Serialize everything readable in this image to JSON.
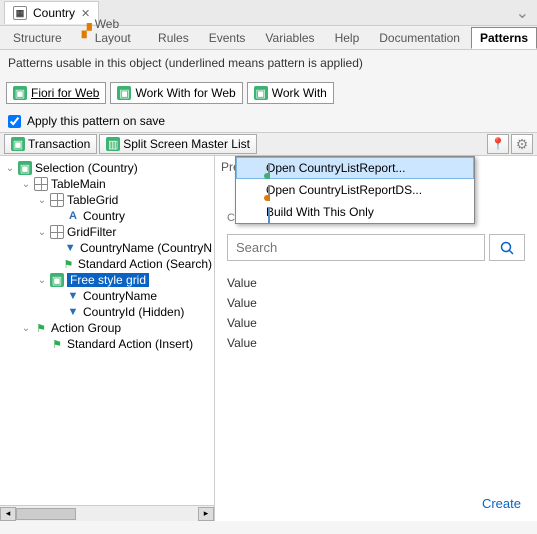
{
  "tab": {
    "title": "Country"
  },
  "subtabs": [
    "Structure",
    "Web Layout",
    "Rules",
    "Events",
    "Variables",
    "Help",
    "Documentation",
    "Patterns"
  ],
  "active_subtab": 7,
  "desc": "Patterns usable in this object (underlined means pattern is applied)",
  "pills": [
    {
      "label": "Fiori for Web",
      "applied": true
    },
    {
      "label": "Work With for Web",
      "applied": false
    },
    {
      "label": "Work With",
      "applied": false
    }
  ],
  "apply_label": "Apply this pattern on save",
  "apply_checked": true,
  "toolbar2": {
    "btn1": "Transaction",
    "btn2": "Split Screen Master List"
  },
  "tree": [
    {
      "ind": 0,
      "tw": "v",
      "icon": "green",
      "label": "Selection (Country)"
    },
    {
      "ind": 1,
      "tw": "v",
      "icon": "grid",
      "label": "TableMain"
    },
    {
      "ind": 2,
      "tw": "v",
      "icon": "grid",
      "label": "TableGrid"
    },
    {
      "ind": 3,
      "tw": "",
      "icon": "a",
      "label": "Country"
    },
    {
      "ind": 2,
      "tw": "v",
      "icon": "grid",
      "label": "GridFilter"
    },
    {
      "ind": 3,
      "tw": "",
      "icon": "funnel",
      "label": "CountryName (CountryN"
    },
    {
      "ind": 3,
      "tw": "",
      "icon": "flag",
      "label": "Standard Action (Search)"
    },
    {
      "ind": 2,
      "tw": "v",
      "icon": "green",
      "label": "Free style grid",
      "selected": true
    },
    {
      "ind": 3,
      "tw": "",
      "icon": "funnel",
      "label": "CountryName"
    },
    {
      "ind": 3,
      "tw": "",
      "icon": "funnel",
      "label": "CountryId (Hidden)"
    },
    {
      "ind": 1,
      "tw": "v",
      "icon": "flag",
      "label": "Action Group"
    },
    {
      "ind": 2,
      "tw": "",
      "icon": "flag",
      "label": "Standard Action (Insert)"
    }
  ],
  "context_menu": [
    "Open CountryListReport...",
    "Open CountryListReportDS...",
    "Build With This Only"
  ],
  "preview": {
    "pre_label": "Pre",
    "header": "COUNTRY",
    "search_placeholder": "Search",
    "values": [
      "Value",
      "Value",
      "Value",
      "Value"
    ],
    "create": "Create"
  }
}
